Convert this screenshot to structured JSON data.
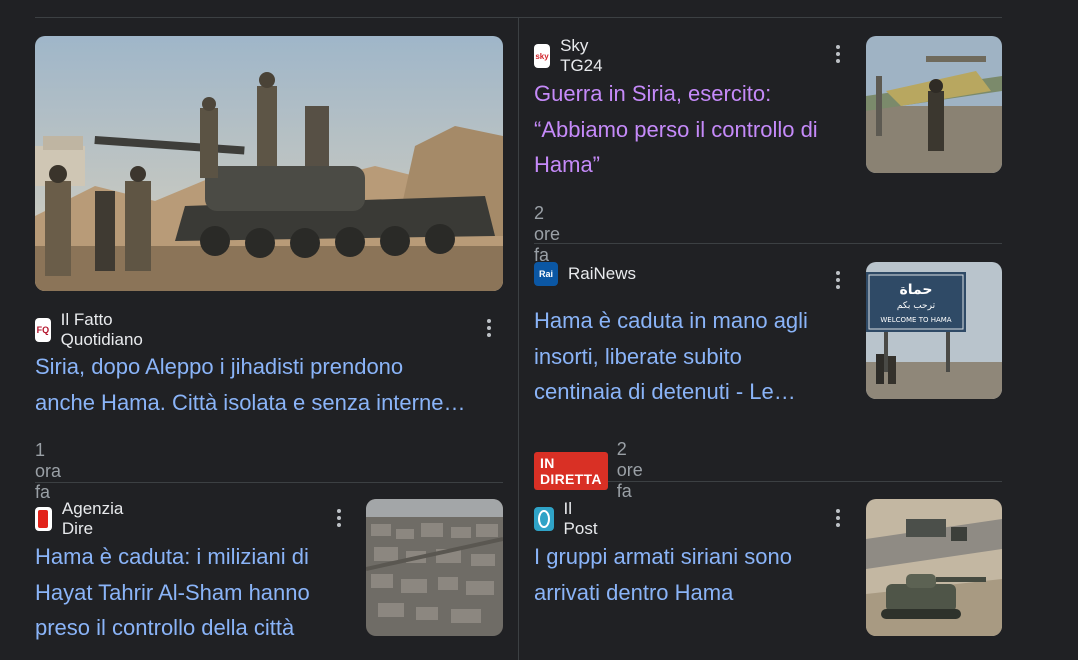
{
  "articles": [
    {
      "source": "Il Fatto Quotidiano",
      "logo_text": "FQ",
      "headline_1": "Siria, dopo Aleppo i jihadisti prendono",
      "headline_2": "anche Hama. Città isolata e senza interne…",
      "time": "1 ora fa"
    },
    {
      "source": "Sky TG24",
      "logo_text": "sky",
      "headline_1": "Guerra in Siria, esercito:",
      "headline_2": "“Abbiamo perso il controllo di",
      "headline_3": "Hama”",
      "time": "2 ore fa"
    },
    {
      "source": "RaiNews",
      "logo_text": "Rai",
      "headline_1": "Hama è caduta in mano agli",
      "headline_2": "insorti, liberate subito",
      "headline_3": "centinaia di detenuti - Le…",
      "badge": "IN DIRETTA",
      "time": "2 ore fa"
    },
    {
      "source": "Agenzia Dire",
      "headline_1": "Hama è caduta: i miliziani di",
      "headline_2": "Hayat Tahrir Al-Sham hanno",
      "headline_3": "preso il controllo della città"
    },
    {
      "source": "Il Post",
      "headline_1": "I gruppi armati siriani sono",
      "headline_2": "arrivati dentro Hama"
    }
  ],
  "thumb_text": {
    "sign_arabic": "حماة",
    "sign_arabic_2": "ترحب بكم",
    "sign_english": "WELCOME TO HAMA"
  }
}
